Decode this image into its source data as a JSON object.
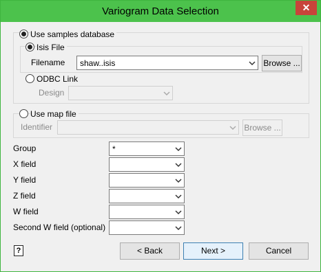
{
  "window": {
    "title": "Variogram Data Selection",
    "close_glyph": "✕"
  },
  "samples": {
    "radio_label": "Use samples database",
    "isis_label": "Isis File",
    "filename_label": "Filename",
    "filename_value": "shaw..isis",
    "browse_label": "Browse ...",
    "odbc_label": "ODBC Link",
    "design_label": "Design",
    "design_value": ""
  },
  "mapfile": {
    "radio_label": "Use map file",
    "identifier_label": "Identifier",
    "identifier_value": "",
    "browse_label": "Browse ..."
  },
  "fields": [
    {
      "label": "Group",
      "value": "*"
    },
    {
      "label": "X field",
      "value": ""
    },
    {
      "label": "Y field",
      "value": ""
    },
    {
      "label": "Z field",
      "value": ""
    },
    {
      "label": "W field",
      "value": ""
    },
    {
      "label": "Second W field (optional)",
      "value": ""
    }
  ],
  "buttons": {
    "back": "< Back",
    "next": "Next >",
    "cancel": "Cancel"
  },
  "help": {
    "glyph": "?",
    "icon": "help-icon"
  }
}
